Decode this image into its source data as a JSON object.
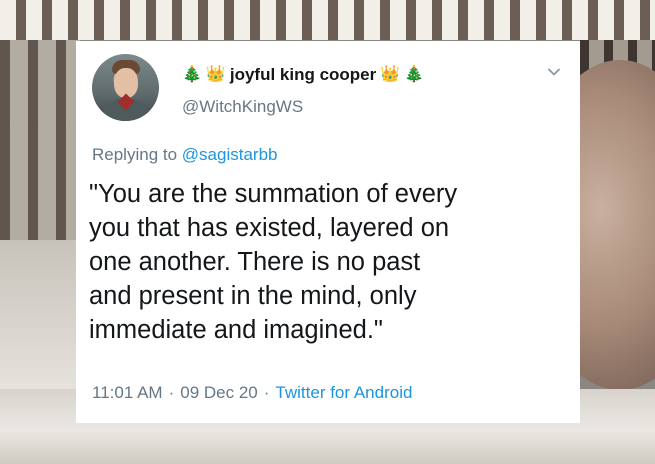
{
  "tweet": {
    "display_name": "joyful king cooper",
    "emoji_left": [
      "🎄",
      "👑"
    ],
    "emoji_right": [
      "👑",
      "🎄"
    ],
    "handle": "@WitchKingWS",
    "replying_prefix": "Replying to",
    "replying_to": "@sagistarbb",
    "text_lines": [
      "\"You are the summation of every",
      "you that has existed, layered on",
      "one another. There is no past",
      "and present in the mind, only",
      "immediate and imagined.\""
    ],
    "time": "11:01 AM",
    "date": "09 Dec 20",
    "source": "Twitter for Android",
    "separator": "·"
  },
  "icons": {
    "menu": "chevron-down-icon",
    "avatar": "avatar"
  },
  "colors": {
    "name": "#14171a",
    "secondary": "#657786",
    "link": "#1b95e0",
    "card": "#ffffff"
  }
}
